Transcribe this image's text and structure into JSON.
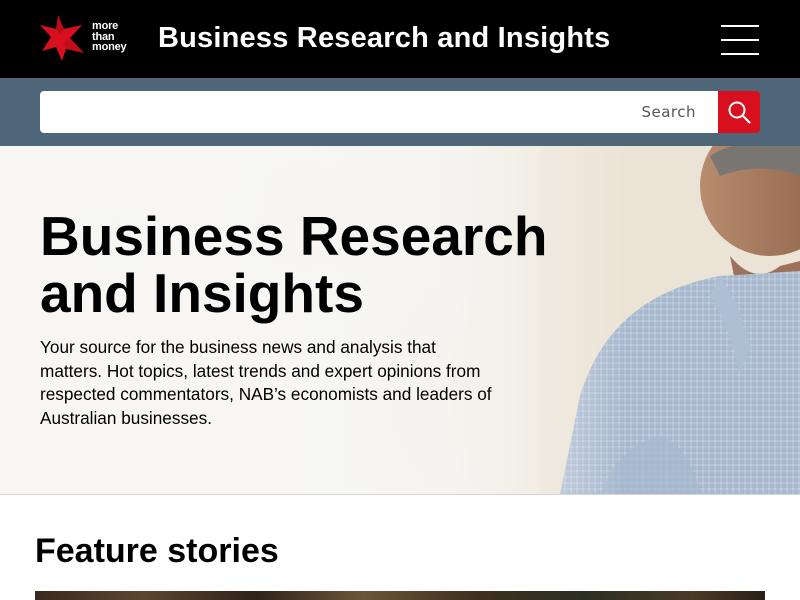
{
  "header": {
    "logo": {
      "line1": "more",
      "line2": "than",
      "line3": "money",
      "star_color": "#d80f1e",
      "icon": "nab-star-logo"
    },
    "site_title": "Business Research and Insights",
    "menu_icon": "hamburger-menu-icon"
  },
  "search": {
    "placeholder": "Search",
    "value": "",
    "button_icon": "search-icon",
    "button_color": "#d80f1e",
    "bar_color": "#4f6678"
  },
  "hero": {
    "title": "Business Research and Insights",
    "subtitle": "Your source for the business news and analysis that matters. Hot topics, latest trends and expert opinions from respected commentators, NAB’s economists and leaders of Australian businesses."
  },
  "features": {
    "heading": "Feature stories"
  },
  "colors": {
    "header_bg": "#000000",
    "accent_red": "#d80f1e"
  }
}
